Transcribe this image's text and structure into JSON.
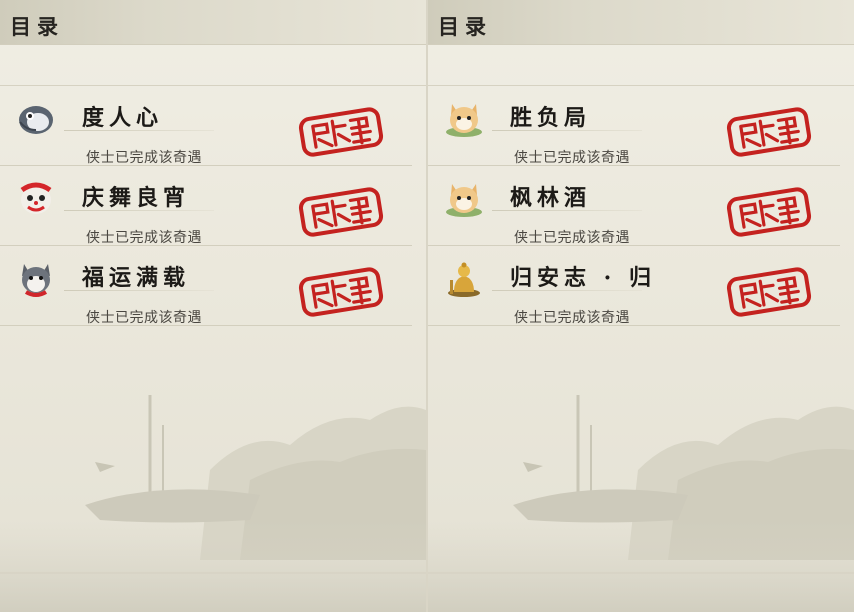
{
  "panels": [
    {
      "header": {
        "title": "目录"
      },
      "items": [
        {
          "title": "度人心",
          "status": "侠士已完成该奇遇",
          "icon": "penguin-icon"
        },
        {
          "title": "庆舞良宵",
          "status": "侠士已完成该奇遇",
          "icon": "lion-dance-icon"
        },
        {
          "title": "福运满载",
          "status": "侠士已完成该奇遇",
          "icon": "husky-dog-icon"
        }
      ]
    },
    {
      "header": {
        "title": "目录"
      },
      "items": [
        {
          "title": "胜负局",
          "status": "侠士已完成该奇遇",
          "icon": "cat-icon"
        },
        {
          "title": "枫林酒",
          "status": "侠士已完成该奇遇",
          "icon": "cat-icon"
        },
        {
          "title": "归安志 · 归",
          "status": "侠士已完成该奇遇",
          "icon": "golden-buddha-icon"
        }
      ]
    }
  ],
  "colors": {
    "stamp_red": "#c4221f",
    "title_text": "#1c1a17",
    "status_text": "#4a4741"
  }
}
